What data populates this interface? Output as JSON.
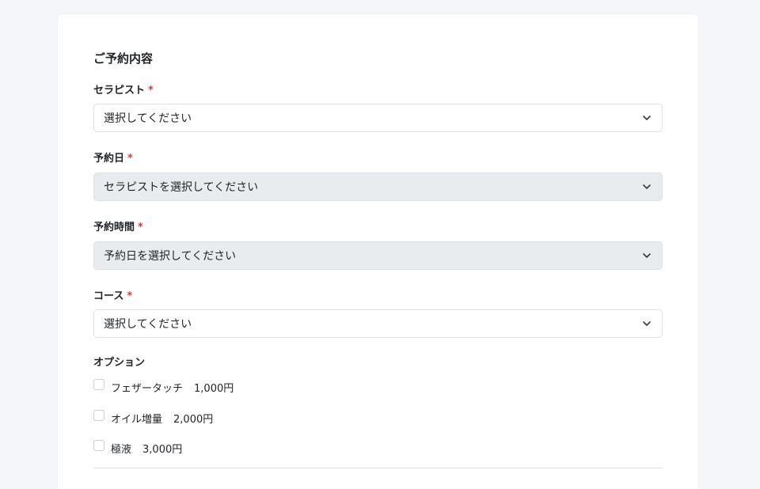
{
  "section": {
    "title": "ご予約内容"
  },
  "required_mark": "*",
  "fields": {
    "therapist": {
      "label": "セラピスト",
      "value": "選択してください",
      "disabled": false
    },
    "date": {
      "label": "予約日",
      "value": "セラピストを選択してください",
      "disabled": true
    },
    "time": {
      "label": "予約時間",
      "value": "予約日を選択してください",
      "disabled": true
    },
    "course": {
      "label": "コース",
      "value": "選択してください",
      "disabled": false
    }
  },
  "options": {
    "label": "オプション",
    "items": [
      {
        "name": "フェザータッチ",
        "price": "1,000円",
        "checked": false
      },
      {
        "name": "オイル増量",
        "price": "2,000円",
        "checked": false
      },
      {
        "name": "極液",
        "price": "3,000円",
        "checked": false
      }
    ]
  },
  "icons": {
    "dropdown": "chevron-down-icon"
  },
  "colors": {
    "required": "#d63a3a",
    "disabled_bg": "#e9ecef",
    "page_bg": "#f4f6f9"
  }
}
